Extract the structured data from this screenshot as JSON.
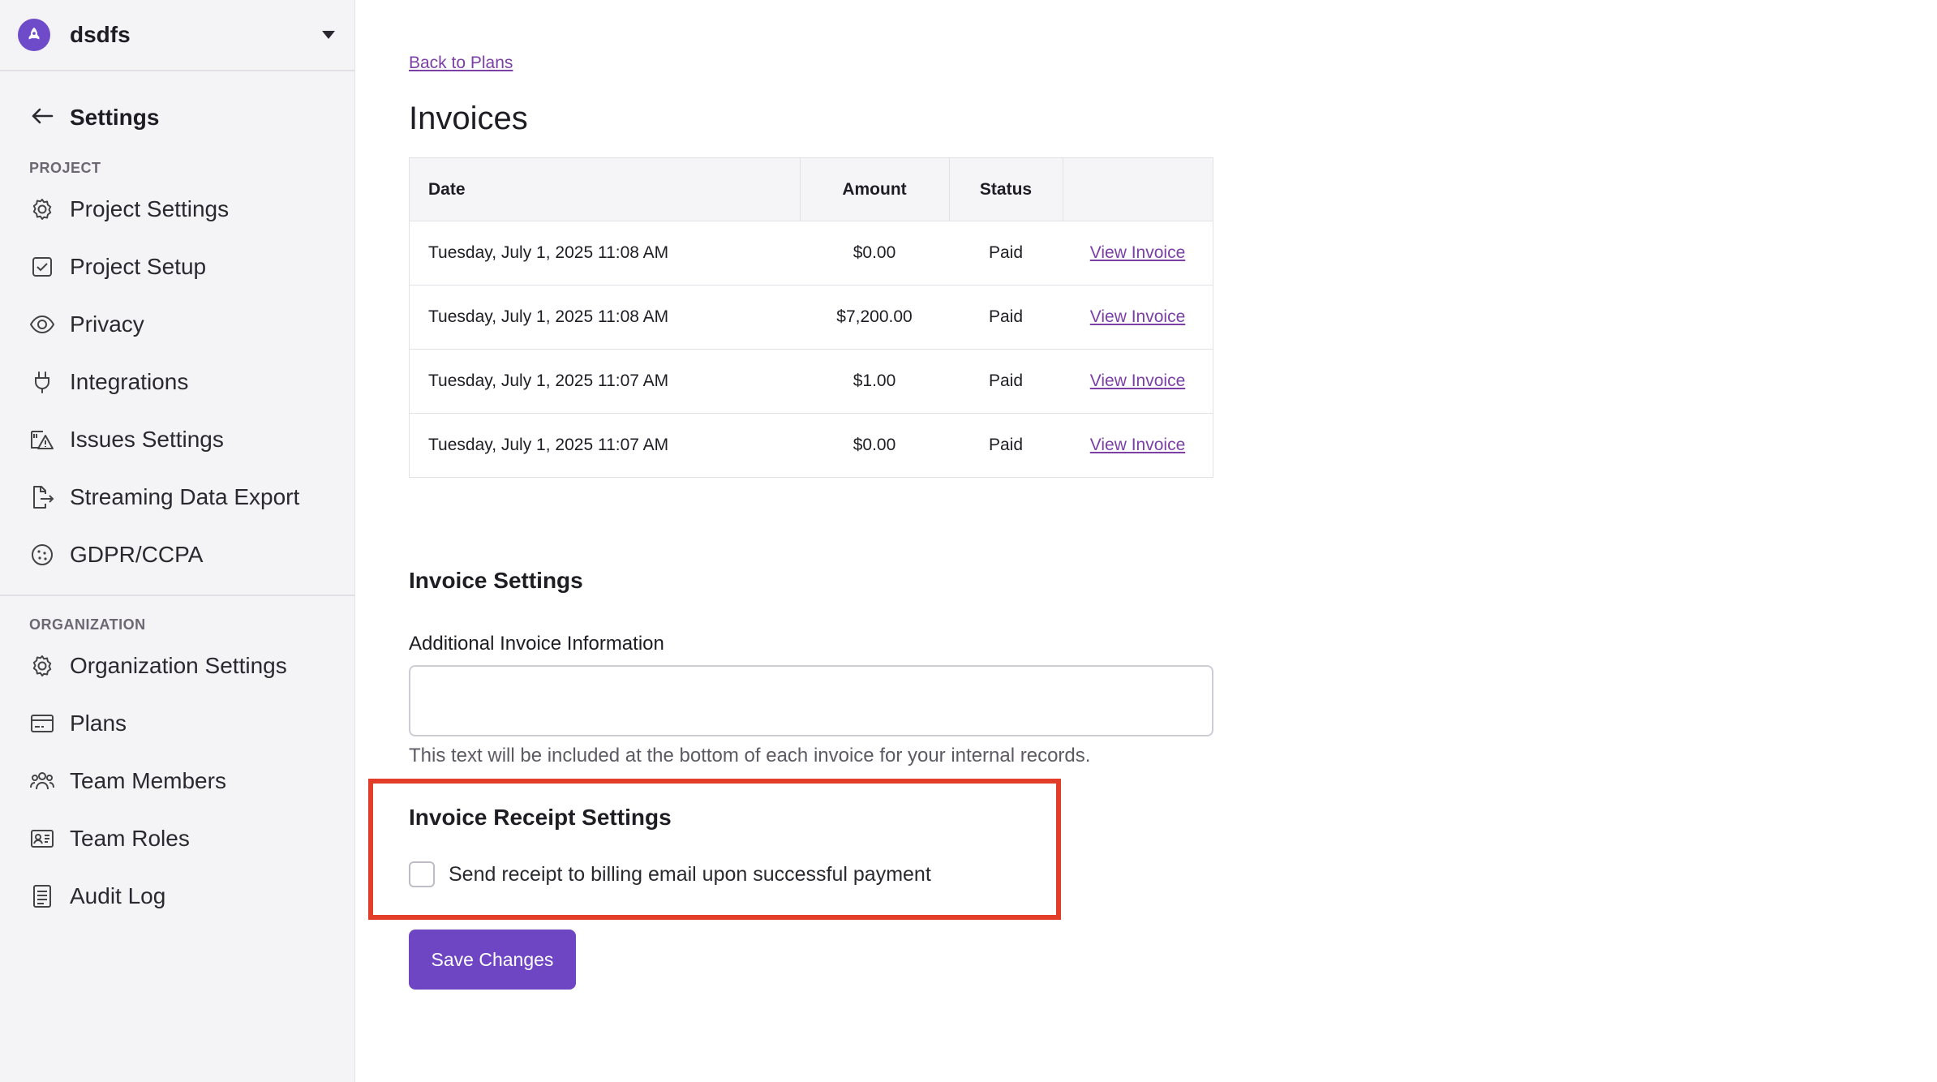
{
  "project": {
    "name": "dsdfs",
    "icon": "rocket-icon"
  },
  "sidebar": {
    "back_label": "Settings",
    "project_section": "PROJECT",
    "project_items": [
      {
        "label": "Project Settings",
        "icon": "gear-icon"
      },
      {
        "label": "Project Setup",
        "icon": "checkbox-icon"
      },
      {
        "label": "Privacy",
        "icon": "eye-icon"
      },
      {
        "label": "Integrations",
        "icon": "plug-icon"
      },
      {
        "label": "Issues Settings",
        "icon": "issues-icon"
      },
      {
        "label": "Streaming Data Export",
        "icon": "export-icon"
      },
      {
        "label": "GDPR/CCPA",
        "icon": "cookie-icon"
      }
    ],
    "org_section": "ORGANIZATION",
    "org_items": [
      {
        "label": "Organization Settings",
        "icon": "gear-icon"
      },
      {
        "label": "Plans",
        "icon": "credit-card-icon"
      },
      {
        "label": "Team Members",
        "icon": "users-icon"
      },
      {
        "label": "Team Roles",
        "icon": "id-card-icon"
      },
      {
        "label": "Audit Log",
        "icon": "document-icon"
      }
    ]
  },
  "main": {
    "back_link": "Back to Plans",
    "title": "Invoices",
    "table": {
      "headers": [
        "Date",
        "Amount",
        "Status",
        ""
      ],
      "rows": [
        {
          "date": "Tuesday, July 1, 2025 11:08 AM",
          "amount": "$0.00",
          "status": "Paid",
          "action": "View Invoice"
        },
        {
          "date": "Tuesday, July 1, 2025 11:08 AM",
          "amount": "$7,200.00",
          "status": "Paid",
          "action": "View Invoice"
        },
        {
          "date": "Tuesday, July 1, 2025 11:07 AM",
          "amount": "$1.00",
          "status": "Paid",
          "action": "View Invoice"
        },
        {
          "date": "Tuesday, July 1, 2025 11:07 AM",
          "amount": "$0.00",
          "status": "Paid",
          "action": "View Invoice"
        }
      ]
    },
    "invoice_settings": {
      "heading": "Invoice Settings",
      "field_label": "Additional Invoice Information",
      "field_value": "",
      "helper": "This text will be included at the bottom of each invoice for your internal records."
    },
    "receipt_settings": {
      "heading": "Invoice Receipt Settings",
      "checkbox_label": "Send receipt to billing email upon successful payment",
      "checked": false
    },
    "save_label": "Save Changes",
    "colors": {
      "accent": "#6e46c4",
      "link": "#7b3fa6",
      "highlight": "#e23d28"
    }
  }
}
